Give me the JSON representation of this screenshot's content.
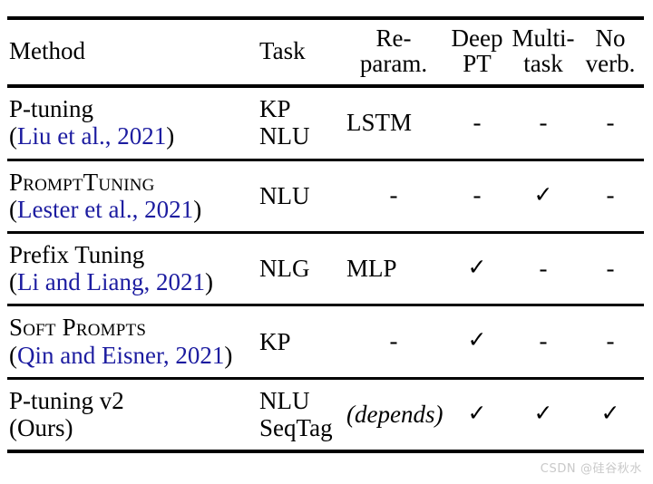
{
  "table": {
    "headers": {
      "method": "Method",
      "task": "Task",
      "reparam_line1": "Re-",
      "reparam_line2": "param.",
      "deep_line1": "Deep",
      "deep_line2": "PT",
      "multi_line1": "Multi-",
      "multi_line2": "task",
      "noverb_line1": "No",
      "noverb_line2": "verb."
    },
    "rows": [
      {
        "method_name": "P-tuning",
        "method_open_paren": "(",
        "method_citation": "Liu et al., 2021",
        "method_close_paren": ")",
        "task_line1": "KP",
        "task_line2": "NLU",
        "reparam": "LSTM",
        "deep_pt": "-",
        "multi_task": "-",
        "no_verb": "-"
      },
      {
        "method_name": "PromptTuning",
        "method_open_paren": "(",
        "method_citation": "Lester et al., 2021",
        "method_close_paren": ")",
        "task_line1": "NLU",
        "task_line2": "",
        "reparam": "-",
        "deep_pt": "-",
        "multi_task": "✓",
        "no_verb": "-"
      },
      {
        "method_name": "Prefix Tuning",
        "method_open_paren": "(",
        "method_citation": "Li and Liang, 2021",
        "method_close_paren": ")",
        "task_line1": "NLG",
        "task_line2": "",
        "reparam": "MLP",
        "deep_pt": "✓",
        "multi_task": "-",
        "no_verb": "-"
      },
      {
        "method_name": "Soft Prompts",
        "method_open_paren": "(",
        "method_citation": "Qin and Eisner, 2021",
        "method_close_paren": ")",
        "task_line1": "KP",
        "task_line2": "",
        "reparam": "-",
        "deep_pt": "✓",
        "multi_task": "-",
        "no_verb": "-"
      },
      {
        "method_name": "P-tuning v2",
        "method_open_paren": "(",
        "method_citation": "Ours",
        "method_close_paren": ")",
        "task_line1": "NLU",
        "task_line2": "SeqTag",
        "reparam": "(depends)",
        "deep_pt": "✓",
        "multi_task": "✓",
        "no_verb": "✓"
      }
    ]
  },
  "watermark": {
    "text": "CSDN @硅谷秋水"
  },
  "colors": {
    "citation_blue": "#1c1ca0",
    "rule_black": "#000000",
    "watermark_gray": "#c9c9c9"
  }
}
